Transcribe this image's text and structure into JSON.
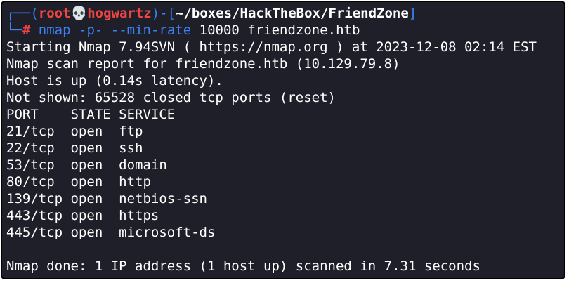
{
  "prompt": {
    "open_corner": "┌──(",
    "user": "root",
    "skull": "💀",
    "host": "hogwartz",
    "close_paren": ")-[",
    "path": "~/boxes/HackTheBox/FriendZone",
    "close_bracket": "]",
    "second_corner": "└─",
    "hash": "#",
    "cmd": "nmap",
    "flag1": "-p-",
    "flag2": "--min-rate",
    "args": "10000 friendzone.htb"
  },
  "output": {
    "starting": "Starting Nmap 7.94SVN ( https://nmap.org ) at 2023-12-08 02:14 EST",
    "report": "Nmap scan report for friendzone.htb (10.129.79.8)",
    "host_up": "Host is up (0.14s latency).",
    "not_shown": "Not shown: 65528 closed tcp ports (reset)",
    "header": "PORT    STATE SERVICE",
    "ports": [
      "21/tcp  open  ftp",
      "22/tcp  open  ssh",
      "53/tcp  open  domain",
      "80/tcp  open  http",
      "139/tcp open  netbios-ssn",
      "443/tcp open  https",
      "445/tcp open  microsoft-ds"
    ],
    "done": "Nmap done: 1 IP address (1 host up) scanned in 7.31 seconds"
  },
  "colors": {
    "background": "#1e1f29",
    "prompt_accent": "#3b82f6",
    "user_host": "#ef4444"
  }
}
